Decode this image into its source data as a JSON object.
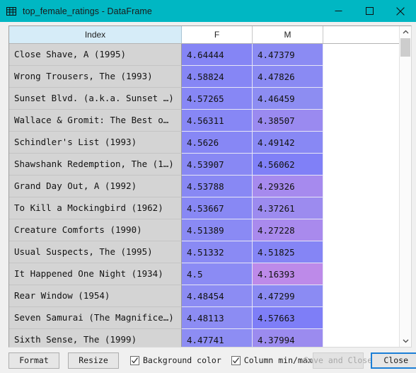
{
  "window": {
    "title": "top_female_ratings - DataFrame",
    "icon": "table-grid-icon",
    "titlebar_color": "#00b7c3",
    "minimize_label": "–",
    "maximize_label": "□",
    "close_label": "×"
  },
  "table": {
    "columns": [
      "Index",
      "F",
      "M"
    ],
    "index_header_selected": true,
    "rows": [
      {
        "index": "Close Shave, A (1995)",
        "F": "4.64444",
        "M": "4.47379",
        "F_color": "#8585f5",
        "M_color": "#8b8bf3"
      },
      {
        "index": "Wrong Trousers, The (1993)",
        "F": "4.58824",
        "M": "4.47826",
        "F_color": "#8686f5",
        "M_color": "#8a8af3"
      },
      {
        "index": "Sunset Blvd. (a.k.a. Sunset …)",
        "F": "4.57265",
        "M": "4.46459",
        "F_color": "#8787f5",
        "M_color": "#8d8df2"
      },
      {
        "index": "Wallace & Gromit: The Best o…",
        "F": "4.56311",
        "M": "4.38507",
        "F_color": "#8787f5",
        "M_color": "#9a8af0"
      },
      {
        "index": "Schindler's List (1993)",
        "F": "4.5626",
        "M": "4.49142",
        "F_color": "#8787f5",
        "M_color": "#8888f4"
      },
      {
        "index": "Shawshank Redemption, The (1…)",
        "F": "4.53907",
        "M": "4.56062",
        "F_color": "#8888f4",
        "M_color": "#8080f7"
      },
      {
        "index": "Grand Day Out, A (1992)",
        "F": "4.53788",
        "M": "4.29326",
        "F_color": "#8888f4",
        "M_color": "#a68aee"
      },
      {
        "index": "To Kill a Mockingbird (1962)",
        "F": "4.53667",
        "M": "4.37261",
        "F_color": "#8888f4",
        "M_color": "#9c8bef"
      },
      {
        "index": "Creature Comforts (1990)",
        "F": "4.51389",
        "M": "4.27228",
        "F_color": "#8a8af4",
        "M_color": "#a98aed"
      },
      {
        "index": "Usual Suspects, The (1995)",
        "F": "4.51332",
        "M": "4.51825",
        "F_color": "#8a8af4",
        "M_color": "#8585f5"
      },
      {
        "index": "It Happened One Night (1934)",
        "F": "4.5",
        "M": "4.16393",
        "F_color": "#8b8bf4",
        "M_color": "#bd8ae9"
      },
      {
        "index": "Rear Window (1954)",
        "F": "4.48454",
        "M": "4.47299",
        "F_color": "#8c8cf3",
        "M_color": "#8b8bf3"
      },
      {
        "index": "Seven Samurai (The Magnifice…)",
        "F": "4.48113",
        "M": "4.57663",
        "F_color": "#8c8cf3",
        "M_color": "#7e7ef7"
      },
      {
        "index": "Sixth Sense, The (1999)",
        "F": "4.47741",
        "M": "4.37994",
        "F_color": "#8d8df3",
        "M_color": "#9b8bef"
      }
    ]
  },
  "scrollbar": {
    "up_arrow": "chevron-up-icon",
    "down_arrow": "chevron-down-icon"
  },
  "toolbar": {
    "format_label": "Format",
    "resize_label": "Resize",
    "background_color_label": "Background color",
    "background_color_checked": true,
    "column_minmax_label": "Column min/max",
    "column_minmax_checked": true,
    "save_and_close_label": "Save and Close",
    "save_and_close_enabled": false,
    "close_label": "Close",
    "focus_color": "#1c7fd6"
  }
}
